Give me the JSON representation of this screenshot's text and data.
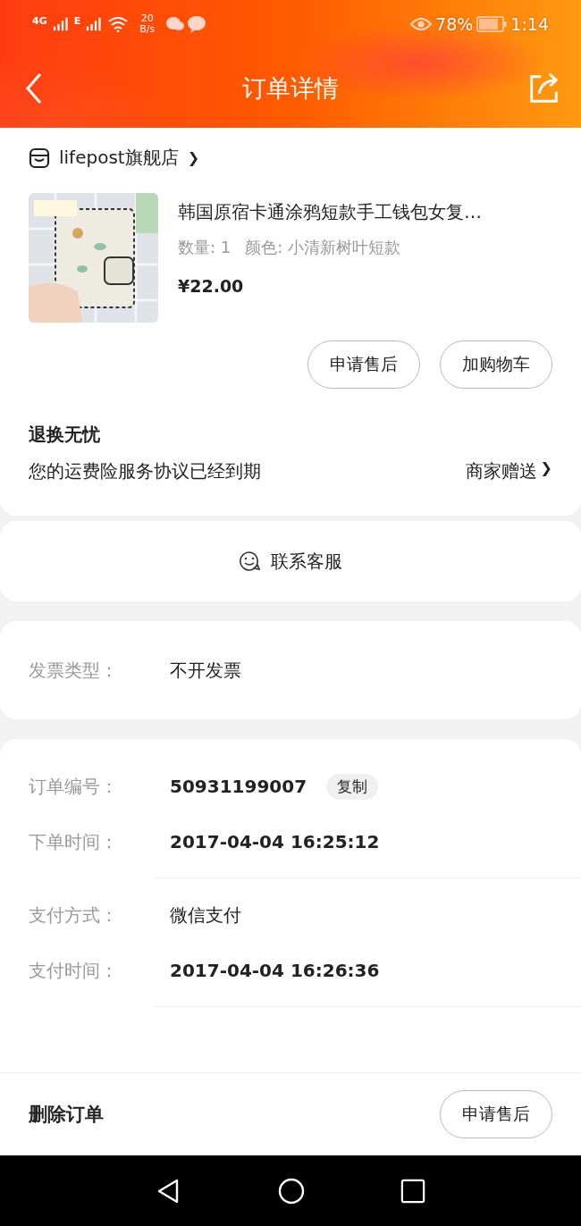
{
  "status_bar": {
    "network_1": "4G",
    "network_2": "E",
    "speed_value": "20",
    "speed_unit": "B/s",
    "battery": "78%",
    "time": "1:14"
  },
  "header": {
    "title": "订单详情"
  },
  "store": {
    "name": "lifepost旗舰店",
    "chevron": "❯"
  },
  "product": {
    "kind": "picture",
    "title": "韩国原宿卡通涂鸦短款手工钱包女复…",
    "quantity": "数量: 1",
    "spec": "颜色: 小清新树叶短款",
    "price": "¥22.00"
  },
  "product_buttons": [
    "申请售后",
    "加购物车"
  ],
  "guarantee": {
    "title": "退换无忧",
    "text": "您的运费险服务协议已经到期",
    "link": "商家赠送",
    "chevron": "❯"
  },
  "contact": {
    "label": "联系客服"
  },
  "invoice": {
    "label": "发票类型：",
    "value": "不开发票"
  },
  "order_info": [
    {
      "rows": [
        {
          "label": "订单编号：",
          "value": "50931199007",
          "emphasis": true,
          "action": "复制"
        },
        {
          "label": "下单时间：",
          "value": "2017-04-04 16:25:12",
          "emphasis": true
        }
      ]
    },
    {
      "rows": [
        {
          "label": "支付方式：",
          "value": "微信支付",
          "emphasis": false
        },
        {
          "label": "支付时间：",
          "value": "2017-04-04 16:26:36",
          "emphasis": true
        }
      ]
    }
  ],
  "bottom_bar": {
    "delete": "删除订单",
    "after_sale": "申请售后"
  }
}
